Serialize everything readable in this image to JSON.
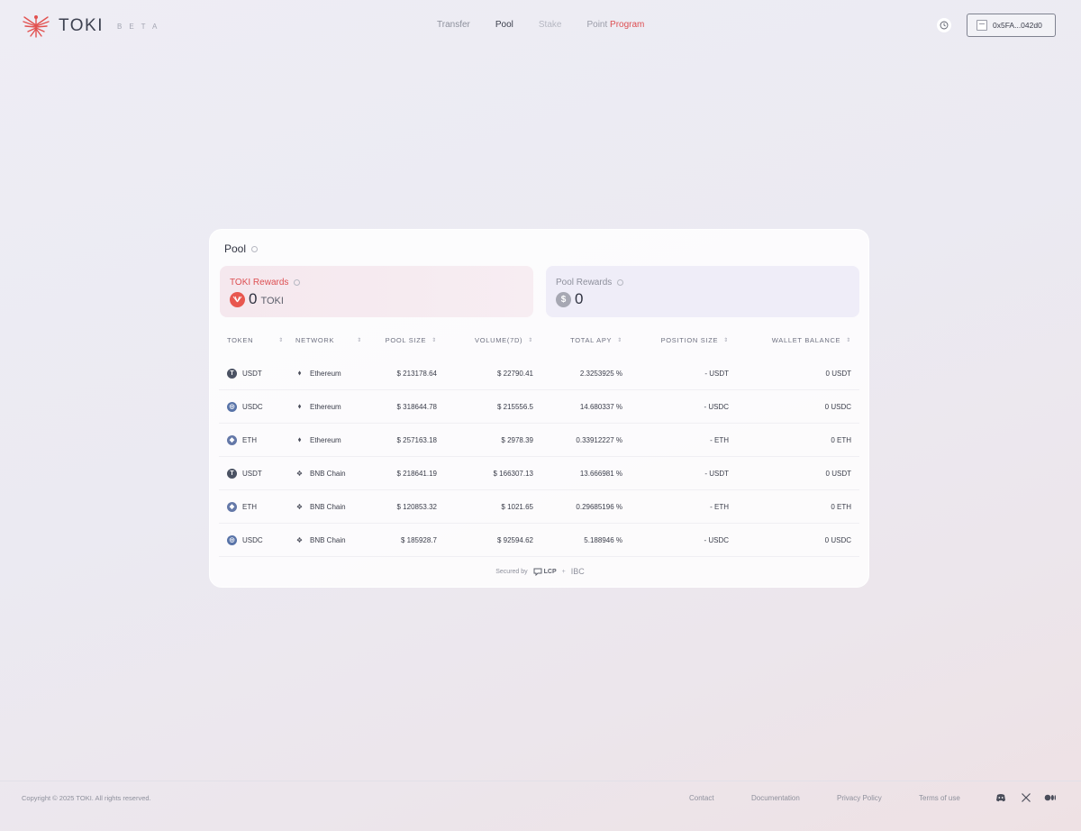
{
  "header": {
    "logo_text": "TOKI",
    "logo_badge": "BETA",
    "nav": {
      "transfer": "Transfer",
      "pool": "Pool",
      "stake": "Stake",
      "point": "Point",
      "program": "Program"
    },
    "wallet_address": "0x5FA...042d0"
  },
  "pool": {
    "title": "Pool",
    "toki_rewards": {
      "label": "TOKI Rewards",
      "value": "0",
      "unit": "TOKI"
    },
    "pool_rewards": {
      "label": "Pool Rewards",
      "value": "0"
    },
    "columns": [
      "TOKEN",
      "NETWORK",
      "POOL SIZE",
      "VOLUME(7D)",
      "TOTAL APY",
      "POSITION SIZE",
      "WALLET BALANCE"
    ],
    "rows": [
      {
        "token": "USDT",
        "network": "Ethereum",
        "pool_size": "$ 213178.64",
        "volume": "$ 22790.41",
        "apy": "2.3253925 %",
        "position": "- USDT",
        "balance": "0 USDT"
      },
      {
        "token": "USDC",
        "network": "Ethereum",
        "pool_size": "$ 318644.78",
        "volume": "$ 215556.5",
        "apy": "14.680337 %",
        "position": "- USDC",
        "balance": "0 USDC"
      },
      {
        "token": "ETH",
        "network": "Ethereum",
        "pool_size": "$ 257163.18",
        "volume": "$ 2978.39",
        "apy": "0.33912227 %",
        "position": "- ETH",
        "balance": "0 ETH"
      },
      {
        "token": "USDT",
        "network": "BNB Chain",
        "pool_size": "$ 218641.19",
        "volume": "$ 166307.13",
        "apy": "13.666981 %",
        "position": "- USDT",
        "balance": "0 USDT"
      },
      {
        "token": "ETH",
        "network": "BNB Chain",
        "pool_size": "$ 120853.32",
        "volume": "$ 1021.65",
        "apy": "0.29685196 %",
        "position": "- ETH",
        "balance": "0 ETH"
      },
      {
        "token": "USDC",
        "network": "BNB Chain",
        "pool_size": "$ 185928.7",
        "volume": "$ 92594.62",
        "apy": "5.188946 %",
        "position": "- USDC",
        "balance": "0 USDC"
      }
    ],
    "secured_by": "Secured by",
    "secured_lcp": "LCP",
    "secured_plus": "+",
    "secured_ibc": "IBC"
  },
  "footer": {
    "copyright": "Copyright © 2025 TOKI. All rights reserved.",
    "links": {
      "contact": "Contact",
      "documentation": "Documentation",
      "privacy": "Privacy Policy",
      "terms": "Terms of use"
    }
  },
  "colors": {
    "accent": "#dd4f52",
    "text": "#3a3d4a"
  }
}
